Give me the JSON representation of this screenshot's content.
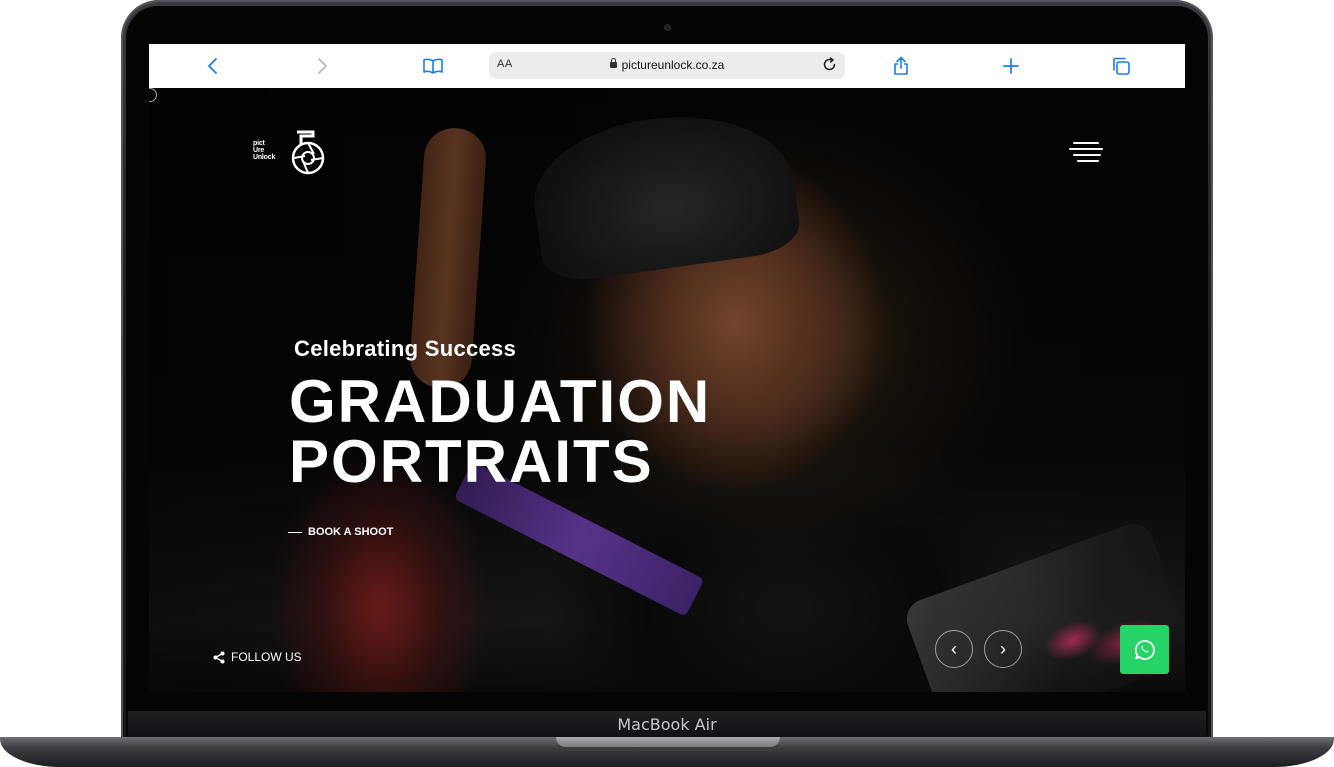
{
  "device": {
    "label": "MacBook Air"
  },
  "browser": {
    "text_size_label": "AA",
    "url": "pictureunlock.co.za",
    "icons": {
      "back": "chevron-left-icon",
      "forward": "chevron-right-icon",
      "bookmarks": "book-icon",
      "reload": "reload-icon",
      "share": "share-icon",
      "new_tab": "plus-icon",
      "tabs": "tabs-icon"
    },
    "accent_color": "#1a7cf1"
  },
  "site": {
    "logo": {
      "text_line1": "pict",
      "text_line2": "Ure",
      "text_line3": "Unlock"
    },
    "hero": {
      "subtitle": "Celebrating Success",
      "title_line1": "GRADUATION",
      "title_line2": "PORTRAITS",
      "cta": "BOOK A SHOOT"
    },
    "social": {
      "label": "FOLLOW US"
    },
    "slider": {
      "prev_symbol": "‹",
      "next_symbol": "›"
    },
    "whatsapp_color": "#25d366"
  }
}
